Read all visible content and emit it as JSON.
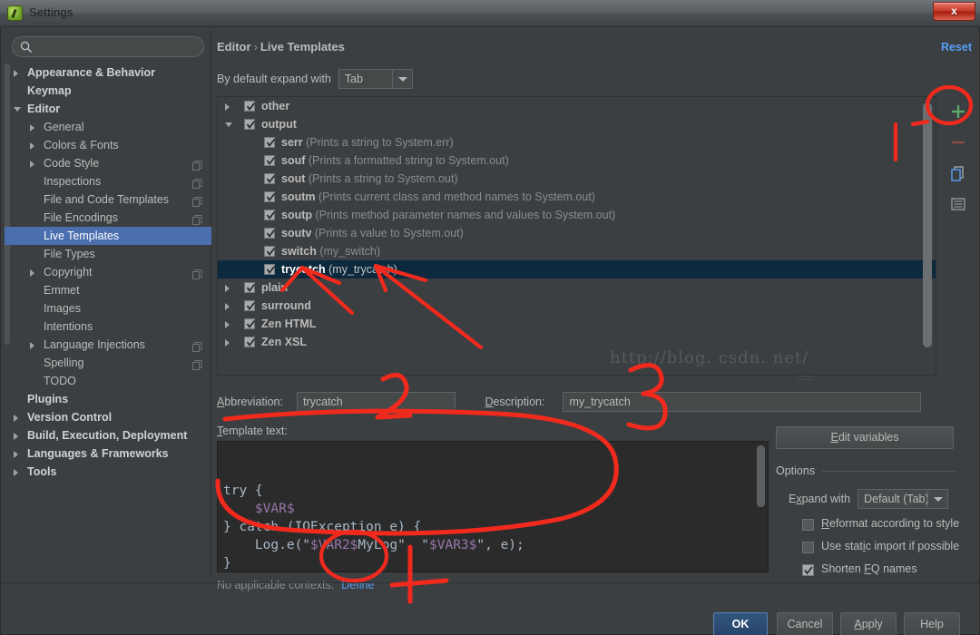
{
  "window": {
    "title": "Settings",
    "close_label": "x",
    "icon": "android-studio-icon"
  },
  "sidebar": {
    "search_placeholder": "",
    "search_value": "",
    "items": [
      {
        "label": "Appearance & Behavior",
        "level": 0,
        "arrow": "closed",
        "bold": true,
        "copy": false,
        "selected": false
      },
      {
        "label": "Keymap",
        "level": 0,
        "arrow": "none",
        "bold": true,
        "copy": false,
        "selected": false
      },
      {
        "label": "Editor",
        "level": 0,
        "arrow": "open",
        "bold": true,
        "copy": false,
        "selected": false
      },
      {
        "label": "General",
        "level": 1,
        "arrow": "closed",
        "bold": false,
        "copy": false,
        "selected": false
      },
      {
        "label": "Colors & Fonts",
        "level": 1,
        "arrow": "closed",
        "bold": false,
        "copy": false,
        "selected": false
      },
      {
        "label": "Code Style",
        "level": 1,
        "arrow": "closed",
        "bold": false,
        "copy": true,
        "selected": false
      },
      {
        "label": "Inspections",
        "level": 1,
        "arrow": "none",
        "bold": false,
        "copy": true,
        "selected": false
      },
      {
        "label": "File and Code Templates",
        "level": 1,
        "arrow": "none",
        "bold": false,
        "copy": true,
        "selected": false
      },
      {
        "label": "File Encodings",
        "level": 1,
        "arrow": "none",
        "bold": false,
        "copy": true,
        "selected": false
      },
      {
        "label": "Live Templates",
        "level": 1,
        "arrow": "none",
        "bold": false,
        "copy": false,
        "selected": true
      },
      {
        "label": "File Types",
        "level": 1,
        "arrow": "none",
        "bold": false,
        "copy": false,
        "selected": false
      },
      {
        "label": "Copyright",
        "level": 1,
        "arrow": "closed",
        "bold": false,
        "copy": true,
        "selected": false
      },
      {
        "label": "Emmet",
        "level": 1,
        "arrow": "none",
        "bold": false,
        "copy": false,
        "selected": false
      },
      {
        "label": "Images",
        "level": 1,
        "arrow": "none",
        "bold": false,
        "copy": false,
        "selected": false
      },
      {
        "label": "Intentions",
        "level": 1,
        "arrow": "none",
        "bold": false,
        "copy": false,
        "selected": false
      },
      {
        "label": "Language Injections",
        "level": 1,
        "arrow": "closed",
        "bold": false,
        "copy": true,
        "selected": false
      },
      {
        "label": "Spelling",
        "level": 1,
        "arrow": "none",
        "bold": false,
        "copy": true,
        "selected": false
      },
      {
        "label": "TODO",
        "level": 1,
        "arrow": "none",
        "bold": false,
        "copy": false,
        "selected": false
      },
      {
        "label": "Plugins",
        "level": 0,
        "arrow": "none",
        "bold": true,
        "copy": false,
        "selected": false
      },
      {
        "label": "Version Control",
        "level": 0,
        "arrow": "closed",
        "bold": true,
        "copy": false,
        "selected": false
      },
      {
        "label": "Build, Execution, Deployment",
        "level": 0,
        "arrow": "closed",
        "bold": true,
        "copy": false,
        "selected": false
      },
      {
        "label": "Languages & Frameworks",
        "level": 0,
        "arrow": "closed",
        "bold": true,
        "copy": false,
        "selected": false
      },
      {
        "label": "Tools",
        "level": 0,
        "arrow": "closed",
        "bold": true,
        "copy": false,
        "selected": false
      }
    ]
  },
  "header": {
    "breadcrumb_root": "Editor",
    "breadcrumb_sep": "›",
    "breadcrumb_leaf": "Live Templates",
    "reset_label": "Reset"
  },
  "expand_default": {
    "label": "By default expand with",
    "value": "Tab"
  },
  "templates_tree": [
    {
      "name": "other",
      "desc": "",
      "group": true,
      "arrow": "closed",
      "checked": true,
      "selected": false
    },
    {
      "name": "output",
      "desc": "",
      "group": true,
      "arrow": "open",
      "checked": true,
      "selected": false
    },
    {
      "name": "serr",
      "desc": "(Prints a string to System.err)",
      "group": false,
      "arrow": "none",
      "checked": true,
      "selected": false
    },
    {
      "name": "souf",
      "desc": "(Prints a formatted string to System.out)",
      "group": false,
      "arrow": "none",
      "checked": true,
      "selected": false
    },
    {
      "name": "sout",
      "desc": "(Prints a string to System.out)",
      "group": false,
      "arrow": "none",
      "checked": true,
      "selected": false
    },
    {
      "name": "soutm",
      "desc": "(Prints current class and method names to System.out)",
      "group": false,
      "arrow": "none",
      "checked": true,
      "selected": false
    },
    {
      "name": "soutp",
      "desc": "(Prints method parameter names and values to System.out)",
      "group": false,
      "arrow": "none",
      "checked": true,
      "selected": false
    },
    {
      "name": "soutv",
      "desc": "(Prints a value to System.out)",
      "group": false,
      "arrow": "none",
      "checked": true,
      "selected": false
    },
    {
      "name": "switch",
      "desc": "(my_switch)",
      "group": false,
      "arrow": "none",
      "checked": true,
      "selected": false
    },
    {
      "name": "trycatch",
      "desc": "(my_trycatch)",
      "group": false,
      "arrow": "none",
      "checked": true,
      "selected": true
    },
    {
      "name": "plain",
      "desc": "",
      "group": true,
      "arrow": "closed",
      "checked": true,
      "selected": false
    },
    {
      "name": "surround",
      "desc": "",
      "group": true,
      "arrow": "closed",
      "checked": true,
      "selected": false
    },
    {
      "name": "Zen HTML",
      "desc": "",
      "group": true,
      "arrow": "closed",
      "checked": true,
      "selected": false
    },
    {
      "name": "Zen XSL",
      "desc": "",
      "group": true,
      "arrow": "closed",
      "checked": true,
      "selected": false
    }
  ],
  "watermark": "http://blog. csdn. net/",
  "toolbar": {
    "add_icon": "plus-icon",
    "remove_icon": "minus-icon",
    "copy_icon": "copy-icon",
    "list_icon": "list-icon"
  },
  "fields": {
    "abbreviation_label": "Abbreviation:",
    "abbreviation_value": "trycatch",
    "description_label": "Description:",
    "description_value": "my_trycatch",
    "template_text_label": "Template text:"
  },
  "editor": {
    "lines": [
      {
        "segments": [
          {
            "t": "try {",
            "c": "plain"
          }
        ]
      },
      {
        "segments": [
          {
            "t": "    ",
            "c": "plain"
          },
          {
            "t": "$VAR$",
            "c": "var"
          }
        ]
      },
      {
        "segments": [
          {
            "t": "} catch (IOException e) {",
            "c": "plain"
          }
        ]
      },
      {
        "segments": [
          {
            "t": "    Log.e(\"",
            "c": "plain"
          },
          {
            "t": "$VAR2$",
            "c": "var"
          },
          {
            "t": "MyLog\", \"",
            "c": "plain"
          },
          {
            "t": "$VAR3$",
            "c": "var"
          },
          {
            "t": "\", e);",
            "c": "plain"
          }
        ]
      },
      {
        "segments": [
          {
            "t": "}",
            "c": "plain"
          }
        ]
      }
    ]
  },
  "context": {
    "message": "No applicable contexts.",
    "define_link": "Define"
  },
  "options": {
    "edit_variables_label": "Edit variables",
    "section_title": "Options",
    "expand_with_label": "Expand with",
    "expand_with_value": "Default (Tab)",
    "checkboxes": [
      {
        "label": "Reformat according to style",
        "checked": false,
        "mnemonic": "R"
      },
      {
        "label": "Use static import if possible",
        "checked": false,
        "mnemonic": "i"
      },
      {
        "label": "Shorten FQ names",
        "checked": true,
        "mnemonic": "F"
      }
    ]
  },
  "footer": {
    "ok": "OK",
    "cancel": "Cancel",
    "apply": "Apply",
    "help": "Help"
  },
  "annotations": {
    "markers": [
      "1",
      "2",
      "3",
      "4"
    ],
    "color": "#f22a1d"
  },
  "colors": {
    "accent_selection": "#4b6eaf",
    "tree_selection": "#0d293e",
    "link": "#589df6",
    "annotation_red": "#f22a1d",
    "variable_purple": "#9876aa",
    "background": "#3c3f41",
    "editor_background": "#2b2b2b"
  }
}
